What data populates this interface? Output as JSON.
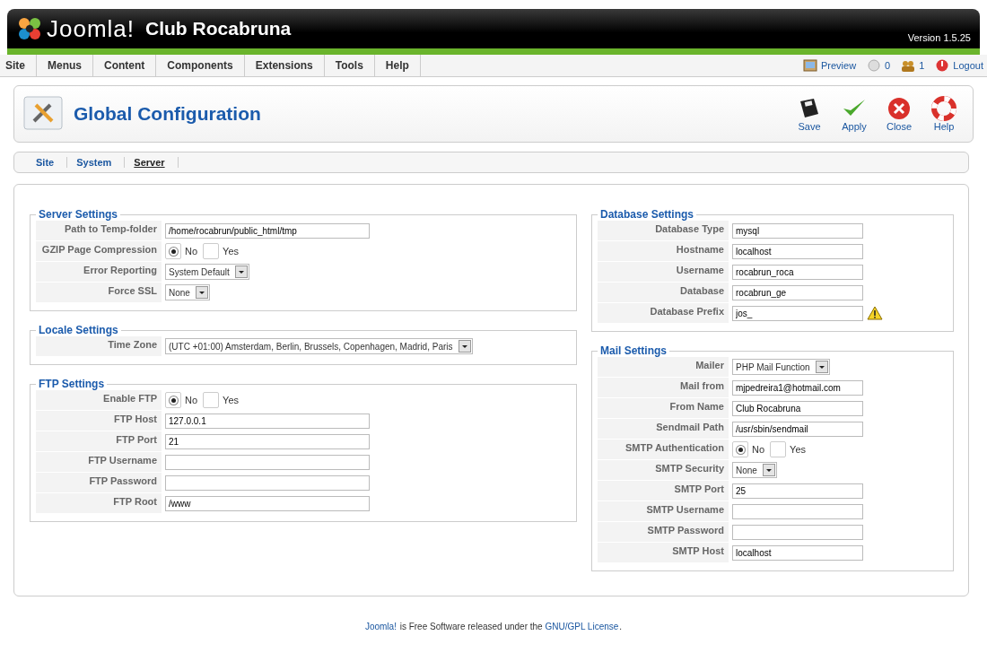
{
  "header": {
    "logo_text": "Joomla!",
    "site_name": "Club Rocabruna",
    "version": "Version 1.5.25"
  },
  "menu": {
    "items": [
      {
        "label": "Site"
      },
      {
        "label": "Menus"
      },
      {
        "label": "Content"
      },
      {
        "label": "Components"
      },
      {
        "label": "Extensions"
      },
      {
        "label": "Tools"
      },
      {
        "label": "Help"
      }
    ],
    "status": [
      {
        "kind": "preview",
        "label": "Preview"
      },
      {
        "kind": "messages",
        "label": "0"
      },
      {
        "kind": "users",
        "label": "1"
      },
      {
        "kind": "logout",
        "label": "Logout"
      }
    ]
  },
  "toolbar": {
    "title": "Global Configuration",
    "buttons": [
      {
        "kind": "save",
        "label": "Save"
      },
      {
        "kind": "apply",
        "label": "Apply"
      },
      {
        "kind": "close",
        "label": "Close"
      },
      {
        "kind": "help",
        "label": "Help"
      }
    ]
  },
  "tabs": [
    {
      "label": "Site",
      "selected": false
    },
    {
      "label": "System",
      "selected": false
    },
    {
      "label": "Server",
      "selected": true
    }
  ],
  "columns": [
    [
      {
        "title": "Server Settings",
        "fields": [
          {
            "label": "Path to Temp-folder",
            "kind": "text",
            "value": "/home/rocabrun/public_html/tmp"
          },
          {
            "label": "GZIP Page Compression",
            "kind": "radio",
            "options": [
              {
                "label": "No",
                "selected": true
              },
              {
                "label": "Yes",
                "selected": false
              }
            ]
          },
          {
            "label": "Error Reporting",
            "kind": "select",
            "value": "System Default"
          },
          {
            "label": "Force SSL",
            "kind": "select",
            "value": "None"
          }
        ]
      },
      {
        "title": "Locale Settings",
        "fields": [
          {
            "label": "Time Zone",
            "kind": "select",
            "value": "(UTC +01:00) Amsterdam, Berlin, Brussels, Copenhagen, Madrid, Paris"
          }
        ]
      },
      {
        "title": "FTP Settings",
        "fields": [
          {
            "label": "Enable FTP",
            "kind": "radio",
            "options": [
              {
                "label": "No",
                "selected": true
              },
              {
                "label": "Yes",
                "selected": false
              }
            ]
          },
          {
            "label": "FTP Host",
            "kind": "text",
            "value": "127.0.0.1"
          },
          {
            "label": "FTP Port",
            "kind": "text",
            "value": "21"
          },
          {
            "label": "FTP Username",
            "kind": "text"
          },
          {
            "label": "FTP Password",
            "kind": "password"
          },
          {
            "label": "FTP Root",
            "kind": "text",
            "value": "/www"
          }
        ]
      }
    ],
    [
      {
        "title": "Database Settings",
        "fields": [
          {
            "label": "Database Type",
            "kind": "text",
            "value": "mysql"
          },
          {
            "label": "Hostname",
            "kind": "text",
            "value": "localhost"
          },
          {
            "label": "Username",
            "kind": "text",
            "value": "rocabrun_roca"
          },
          {
            "label": "Database",
            "kind": "text",
            "value": "rocabrun_ge"
          },
          {
            "label": "Database Prefix",
            "kind": "text",
            "value": "jos_",
            "warning": true
          }
        ]
      },
      {
        "title": "Mail Settings",
        "fields": [
          {
            "label": "Mailer",
            "kind": "select",
            "value": "PHP Mail Function"
          },
          {
            "label": "Mail from",
            "kind": "text",
            "value": "mjpedreira1@hotmail.com"
          },
          {
            "label": "From Name",
            "kind": "text",
            "value": "Club Rocabruna"
          },
          {
            "label": "Sendmail Path",
            "kind": "text",
            "value": "/usr/sbin/sendmail"
          },
          {
            "label": "SMTP Authentication",
            "kind": "radio",
            "options": [
              {
                "label": "No",
                "selected": true
              },
              {
                "label": "Yes",
                "selected": false
              }
            ]
          },
          {
            "label": "SMTP Security",
            "kind": "select",
            "value": "None"
          },
          {
            "label": "SMTP Port",
            "kind": "text",
            "value": "25"
          },
          {
            "label": "SMTP Username",
            "kind": "text"
          },
          {
            "label": "SMTP Password",
            "kind": "password"
          },
          {
            "label": "SMTP Host",
            "kind": "text",
            "value": "localhost"
          }
        ]
      }
    ]
  ],
  "footer": [
    {
      "text": "Joomla!",
      "link": true
    },
    {
      "text": " is Free Software released under the ",
      "link": false
    },
    {
      "text": "GNU/GPL License",
      "link": true
    },
    {
      "text": ".",
      "link": false
    }
  ]
}
